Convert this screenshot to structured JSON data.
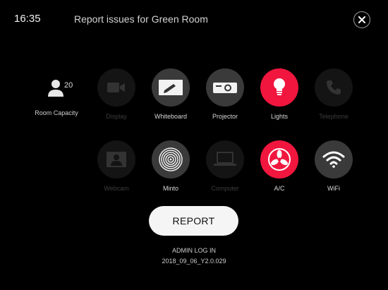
{
  "header": {
    "time": "16:35",
    "title": "Report issues for Green Room"
  },
  "capacity": {
    "count": "20",
    "label": "Room Capacity"
  },
  "devices": [
    {
      "label": "Display",
      "icon": "video-camera-icon",
      "state": "disabled"
    },
    {
      "label": "Whiteboard",
      "icon": "whiteboard-icon",
      "state": "normal"
    },
    {
      "label": "Projector",
      "icon": "projector-icon",
      "state": "normal"
    },
    {
      "label": "Lights",
      "icon": "lightbulb-icon",
      "state": "selected"
    },
    {
      "label": "Telephone",
      "icon": "telephone-icon",
      "state": "disabled"
    },
    {
      "label": "Webcam",
      "icon": "webcam-icon",
      "state": "disabled"
    },
    {
      "label": "Minto",
      "icon": "minto-speaker-icon",
      "state": "normal"
    },
    {
      "label": "Computer",
      "icon": "laptop-icon",
      "state": "disabled"
    },
    {
      "label": "A/C",
      "icon": "fan-icon",
      "state": "selected"
    },
    {
      "label": "WiFi",
      "icon": "wifi-icon",
      "state": "normal"
    }
  ],
  "actions": {
    "report_label": "REPORT",
    "admin_label": "ADMIN LOG IN"
  },
  "footer": {
    "version": "2018_09_06_Y2.0.029"
  },
  "colors": {
    "accent": "#f0163e",
    "background": "#000000"
  }
}
